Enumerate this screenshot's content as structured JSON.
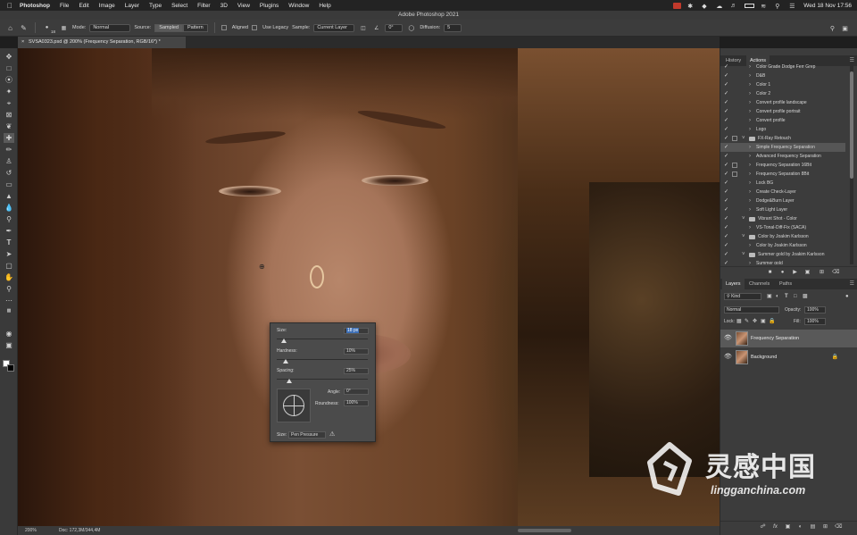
{
  "menubar": {
    "app": "Photoshop",
    "items": [
      "File",
      "Edit",
      "Image",
      "Layer",
      "Type",
      "Select",
      "Filter",
      "3D",
      "View",
      "Plugins",
      "Window",
      "Help"
    ],
    "clock": "Wed 18 Nov  17:56"
  },
  "window_title": "Adobe Photoshop 2021",
  "options": {
    "brush_size": "18",
    "mode_label": "Mode:",
    "mode_value": "Normal",
    "source_label": "Source:",
    "source_sampled": "Sampled",
    "source_pattern": "Pattern",
    "aligned": "Aligned",
    "use_legacy": "Use Legacy",
    "sample_label": "Sample:",
    "sample_value": "Current Layer",
    "angle_value": "0°",
    "diffusion_label": "Diffusion:",
    "diffusion_value": "5"
  },
  "doc_tab": "SVSA0323.psd @ 200% (Frequency Separation, RGB/16*) *",
  "brush_popup": {
    "size_label": "Size:",
    "size_value": "18 px",
    "hardness_label": "Hardness:",
    "hardness_value": "10%",
    "spacing_label": "Spacing:",
    "spacing_value": "25%",
    "angle_label": "Angle:",
    "angle_value": "0°",
    "roundness_label": "Roundness:",
    "roundness_value": "100%",
    "control_label": "Size:",
    "control_value": "Pen Pressure",
    "size_slider": 0.08,
    "hardness_slider": 0.1,
    "spacing_slider": 0.14
  },
  "status": {
    "zoom": "200%",
    "doc": "Doc: 172,3M/344,4M"
  },
  "panel_top": {
    "tabs": [
      "History",
      "Actions"
    ],
    "active_tab": "Actions",
    "actions": [
      {
        "name": "Color Grade Dodge Ferr Grep",
        "indent": 2,
        "check": true,
        "box": false,
        "kind": "action"
      },
      {
        "name": "D&B",
        "indent": 2,
        "check": true,
        "box": false,
        "kind": "action"
      },
      {
        "name": "Color 1",
        "indent": 2,
        "check": true,
        "box": false,
        "kind": "action"
      },
      {
        "name": "Color 2",
        "indent": 2,
        "check": true,
        "box": false,
        "kind": "action"
      },
      {
        "name": "Convert profile landscape",
        "indent": 2,
        "check": true,
        "box": false,
        "kind": "action"
      },
      {
        "name": "Convert profile portrait",
        "indent": 2,
        "check": true,
        "box": false,
        "kind": "action"
      },
      {
        "name": "Convert profile",
        "indent": 2,
        "check": true,
        "box": false,
        "kind": "action"
      },
      {
        "name": "Logo",
        "indent": 2,
        "check": true,
        "box": false,
        "kind": "action"
      },
      {
        "name": "FX-Ray Retouch",
        "indent": 1,
        "check": true,
        "box": true,
        "kind": "set"
      },
      {
        "name": "Simple Frequency Separation",
        "indent": 2,
        "check": true,
        "box": false,
        "kind": "action",
        "highlight": true
      },
      {
        "name": "Advanced Frequency Separation",
        "indent": 2,
        "check": true,
        "box": false,
        "kind": "action"
      },
      {
        "name": "Frequency Separation 16Bit",
        "indent": 2,
        "check": true,
        "box": true,
        "kind": "action"
      },
      {
        "name": "Frequency Separation 8Bit",
        "indent": 2,
        "check": true,
        "box": true,
        "kind": "action"
      },
      {
        "name": "Lock BG",
        "indent": 2,
        "check": true,
        "box": false,
        "kind": "action"
      },
      {
        "name": "Create Check-Layer",
        "indent": 2,
        "check": true,
        "box": false,
        "kind": "action"
      },
      {
        "name": "Dodge&Burn Layer",
        "indent": 2,
        "check": true,
        "box": false,
        "kind": "action"
      },
      {
        "name": "Soft Light Layer",
        "indent": 2,
        "check": true,
        "box": false,
        "kind": "action"
      },
      {
        "name": "Vibrant Shot - Color",
        "indent": 1,
        "check": true,
        "box": false,
        "kind": "set"
      },
      {
        "name": "VS-Tonal-Diff-Fix (SACA)",
        "indent": 2,
        "check": true,
        "box": false,
        "kind": "action"
      },
      {
        "name": "Color by Joakim Karlsson",
        "indent": 1,
        "check": true,
        "box": false,
        "kind": "set"
      },
      {
        "name": "Color by Joakim Karlsson",
        "indent": 2,
        "check": true,
        "box": false,
        "kind": "action"
      },
      {
        "name": "Summer gold by Joakim Karlsson",
        "indent": 1,
        "check": true,
        "box": false,
        "kind": "set"
      },
      {
        "name": "Summer gold",
        "indent": 2,
        "check": true,
        "box": false,
        "kind": "action"
      }
    ]
  },
  "layers_panel": {
    "tabs": [
      "Layers",
      "Channels",
      "Paths"
    ],
    "active_tab": "Layers",
    "filter_value": "Kind",
    "blend_mode": "Normal",
    "opacity_label": "Opacity:",
    "opacity_value": "100%",
    "lock_label": "Lock:",
    "fill_label": "Fill:",
    "fill_value": "100%",
    "layers": [
      {
        "name": "Frequency Separation",
        "selected": true,
        "locked": false
      },
      {
        "name": "Background",
        "selected": false,
        "locked": true
      }
    ]
  },
  "watermark": {
    "chinese": "灵感中国",
    "domain": "lingganchina.com"
  },
  "colors": {
    "accent": "#3d6fb6",
    "panel_bg": "#3c3c3c",
    "selected_layer": "#595959"
  }
}
